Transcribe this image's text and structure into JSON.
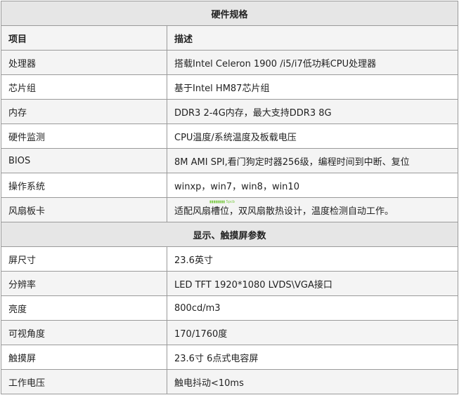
{
  "sections": [
    {
      "title": "硬件规格",
      "header": [
        "项目",
        "描述"
      ],
      "rows": [
        [
          "处理器",
          "搭载Intel Celeron 1900 /i5/i7低功耗CPU处理器"
        ],
        [
          "芯片组",
          "基于Intel HM87芯片组"
        ],
        [
          "内存",
          "DDR3 2-4G内存，最大支持DDR3 8G"
        ],
        [
          "硬件监测",
          "CPU温度/系统温度及板载电压"
        ],
        [
          "BIOS",
          "8M AMI SPI,看门狗定时器256级，编程时间到中断、复位"
        ],
        [
          "操作系统",
          "winxp，win7，win8，win10"
        ],
        [
          "风扇板卡",
          "适配风扇槽位，双风扇散热设计，温度检测自动工作。"
        ]
      ]
    },
    {
      "title": "显示、触摸屏参数",
      "rows": [
        [
          "屏尺寸",
          "23.6英寸"
        ],
        [
          "分辨率",
          "LED TFT 1920*1080 LVDS\\VGA接口"
        ],
        [
          "亮度",
          "800cd/m3"
        ],
        [
          "可视角度",
          "170/1760度"
        ],
        [
          "触摸屏",
          "23.6寸 6点式电容屏"
        ],
        [
          "工作电压",
          "触电抖动<10ms"
        ]
      ]
    }
  ]
}
